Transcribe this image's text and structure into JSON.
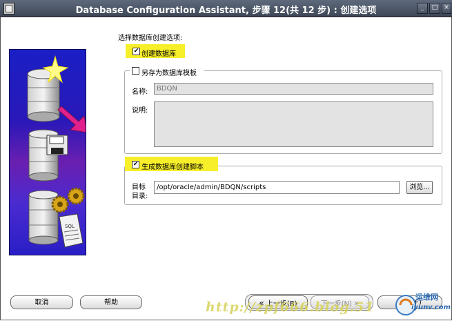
{
  "window": {
    "title": "Database Configuration Assistant, 步骤 12(共 12 步) : 创建选项"
  },
  "main": {
    "header_label": "选择数据库创建选项:",
    "create_db": {
      "label": "创建数据库",
      "checked": true
    },
    "save_template": {
      "label": "另存为数据库模板",
      "checked": false
    },
    "name_label": "名称:",
    "name_value": "BDQN",
    "desc_label": "说明:",
    "desc_value": "",
    "gen_scripts": {
      "label": "生成数据库创建脚本",
      "checked": true
    },
    "dir_label_1": "目标",
    "dir_label_2": "目录:",
    "dir_value": "/opt/oracle/admin/BDQN/scripts",
    "browse_label": "浏览..."
  },
  "footer": {
    "cancel_label": "取消",
    "help_label": "帮助",
    "back_label": "上一步(B)",
    "next_label": "下一步(N)",
    "finish_label": "完成(F)"
  },
  "watermark": {
    "text": "http://zpf666.blog.51",
    "logo_text": "运维网",
    "logo_sub": "iyunv.com"
  },
  "illustration": {
    "sql_text": "SQL"
  },
  "colors": {
    "highlight": "#f7ef2a",
    "titlebar": "#4a5466",
    "illustration_bg": "#2a18b8",
    "arrow": "#e0208c"
  }
}
